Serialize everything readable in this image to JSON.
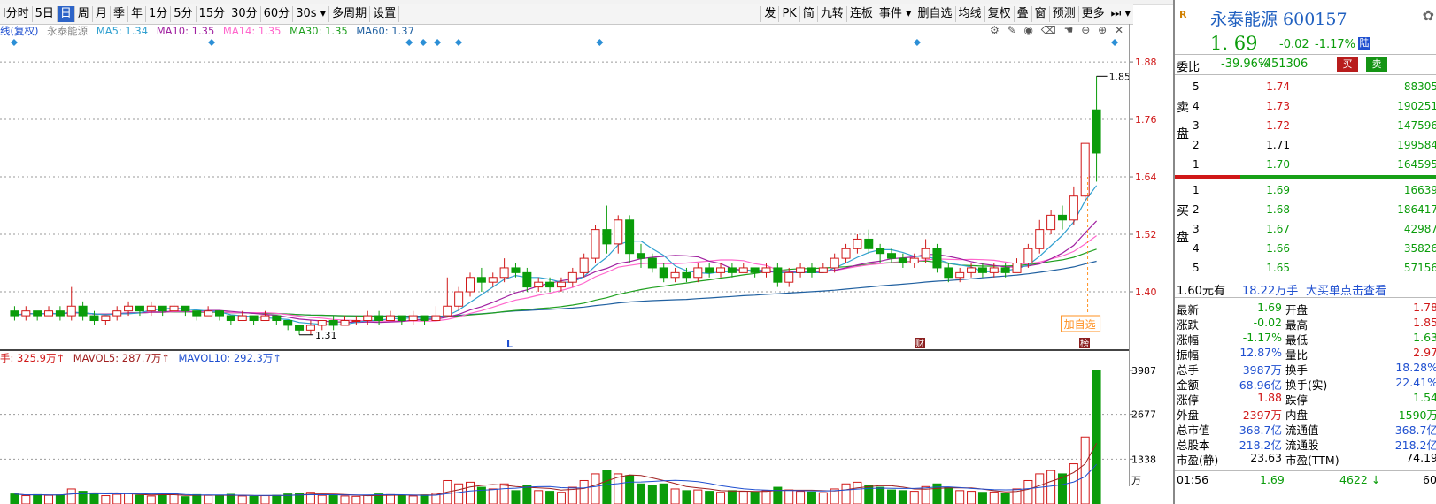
{
  "toolbar": {
    "items": [
      "l分时",
      "5日",
      "日",
      "周",
      "月",
      "季",
      "年",
      "1分",
      "5分",
      "15分",
      "30分",
      "60分",
      "30s ▾",
      "多周期",
      "设置"
    ],
    "active_index": 2,
    "right_items": [
      "发",
      "PK",
      "简",
      "九转",
      "连板",
      "事件 ▾",
      "删自选",
      "均线",
      "复权",
      "叠",
      "窗",
      "预测",
      "更多",
      "⏭ ▾"
    ]
  },
  "ma_line": {
    "prefix": "线(复权)",
    "stock": "永泰能源",
    "ma5": "MA5: 1.34",
    "ma10": "MA10: 1.35",
    "ma14": "MA14: 1.35",
    "ma30": "MA30: 1.35",
    "ma60": "MA60: 1.37"
  },
  "colors": {
    "ma5": "#30a0d0",
    "ma10": "#a020a0",
    "ma14": "#ff66cc",
    "ma30": "#20a020",
    "ma60": "#2060a0",
    "up": "#d01818",
    "down": "#0a9c0a"
  },
  "axis": {
    "price_ticks": [
      "1.88",
      "1.76",
      "1.64",
      "1.52",
      "1.40"
    ],
    "vol_ticks": [
      "3987",
      "2677",
      "1338",
      "万"
    ]
  },
  "annotations": {
    "low": "1.31",
    "high": "1.85",
    "add_watch": "加自选",
    "mark_L": "L",
    "mark_cai": "财",
    "mark_bang": "榜"
  },
  "volume_line": {
    "vol": "手: 325.9万↑",
    "mavol5": "MAVOL5: 287.7万↑",
    "mavol10": "MAVOL10: 292.3万↑"
  },
  "chart_data": {
    "type": "candlestick",
    "price_range": [
      1.28,
      1.93
    ],
    "volume_max": 3987,
    "candles": [
      {
        "o": 1.36,
        "c": 1.35,
        "h": 1.37,
        "l": 1.34,
        "v": 300
      },
      {
        "o": 1.35,
        "c": 1.36,
        "h": 1.37,
        "l": 1.34,
        "v": 250
      },
      {
        "o": 1.36,
        "c": 1.35,
        "h": 1.36,
        "l": 1.34,
        "v": 280
      },
      {
        "o": 1.35,
        "c": 1.36,
        "h": 1.37,
        "l": 1.35,
        "v": 260
      },
      {
        "o": 1.36,
        "c": 1.35,
        "h": 1.37,
        "l": 1.34,
        "v": 270
      },
      {
        "o": 1.35,
        "c": 1.37,
        "h": 1.41,
        "l": 1.34,
        "v": 450
      },
      {
        "o": 1.37,
        "c": 1.35,
        "h": 1.38,
        "l": 1.34,
        "v": 380
      },
      {
        "o": 1.35,
        "c": 1.34,
        "h": 1.36,
        "l": 1.33,
        "v": 300
      },
      {
        "o": 1.34,
        "c": 1.35,
        "h": 1.35,
        "l": 1.33,
        "v": 250
      },
      {
        "o": 1.35,
        "c": 1.36,
        "h": 1.37,
        "l": 1.34,
        "v": 290
      },
      {
        "o": 1.36,
        "c": 1.37,
        "h": 1.38,
        "l": 1.35,
        "v": 320
      },
      {
        "o": 1.37,
        "c": 1.36,
        "h": 1.37,
        "l": 1.35,
        "v": 260
      },
      {
        "o": 1.36,
        "c": 1.37,
        "h": 1.38,
        "l": 1.35,
        "v": 240
      },
      {
        "o": 1.37,
        "c": 1.36,
        "h": 1.37,
        "l": 1.35,
        "v": 270
      },
      {
        "o": 1.36,
        "c": 1.37,
        "h": 1.38,
        "l": 1.36,
        "v": 300
      },
      {
        "o": 1.37,
        "c": 1.36,
        "h": 1.37,
        "l": 1.35,
        "v": 220
      },
      {
        "o": 1.36,
        "c": 1.35,
        "h": 1.36,
        "l": 1.34,
        "v": 280
      },
      {
        "o": 1.35,
        "c": 1.36,
        "h": 1.37,
        "l": 1.35,
        "v": 260
      },
      {
        "o": 1.36,
        "c": 1.35,
        "h": 1.36,
        "l": 1.34,
        "v": 250
      },
      {
        "o": 1.35,
        "c": 1.34,
        "h": 1.35,
        "l": 1.33,
        "v": 290
      },
      {
        "o": 1.34,
        "c": 1.35,
        "h": 1.36,
        "l": 1.34,
        "v": 240
      },
      {
        "o": 1.35,
        "c": 1.34,
        "h": 1.35,
        "l": 1.33,
        "v": 230
      },
      {
        "o": 1.34,
        "c": 1.35,
        "h": 1.36,
        "l": 1.34,
        "v": 250
      },
      {
        "o": 1.35,
        "c": 1.34,
        "h": 1.35,
        "l": 1.33,
        "v": 260
      },
      {
        "o": 1.34,
        "c": 1.33,
        "h": 1.34,
        "l": 1.32,
        "v": 300
      },
      {
        "o": 1.33,
        "c": 1.32,
        "h": 1.33,
        "l": 1.31,
        "v": 330
      },
      {
        "o": 1.32,
        "c": 1.33,
        "h": 1.34,
        "l": 1.31,
        "v": 350
      },
      {
        "o": 1.33,
        "c": 1.34,
        "h": 1.34,
        "l": 1.32,
        "v": 260
      },
      {
        "o": 1.34,
        "c": 1.33,
        "h": 1.35,
        "l": 1.32,
        "v": 250
      },
      {
        "o": 1.33,
        "c": 1.34,
        "h": 1.35,
        "l": 1.33,
        "v": 240
      },
      {
        "o": 1.34,
        "c": 1.34,
        "h": 1.35,
        "l": 1.33,
        "v": 230
      },
      {
        "o": 1.34,
        "c": 1.35,
        "h": 1.36,
        "l": 1.33,
        "v": 260
      },
      {
        "o": 1.35,
        "c": 1.34,
        "h": 1.36,
        "l": 1.33,
        "v": 300
      },
      {
        "o": 1.34,
        "c": 1.35,
        "h": 1.36,
        "l": 1.34,
        "v": 280
      },
      {
        "o": 1.35,
        "c": 1.34,
        "h": 1.35,
        "l": 1.33,
        "v": 260
      },
      {
        "o": 1.34,
        "c": 1.35,
        "h": 1.36,
        "l": 1.33,
        "v": 240
      },
      {
        "o": 1.35,
        "c": 1.34,
        "h": 1.35,
        "l": 1.33,
        "v": 270
      },
      {
        "o": 1.34,
        "c": 1.35,
        "h": 1.37,
        "l": 1.34,
        "v": 320
      },
      {
        "o": 1.35,
        "c": 1.37,
        "h": 1.43,
        "l": 1.35,
        "v": 700
      },
      {
        "o": 1.37,
        "c": 1.4,
        "h": 1.41,
        "l": 1.36,
        "v": 600
      },
      {
        "o": 1.4,
        "c": 1.43,
        "h": 1.44,
        "l": 1.39,
        "v": 650
      },
      {
        "o": 1.43,
        "c": 1.42,
        "h": 1.45,
        "l": 1.4,
        "v": 500
      },
      {
        "o": 1.42,
        "c": 1.43,
        "h": 1.44,
        "l": 1.41,
        "v": 450
      },
      {
        "o": 1.43,
        "c": 1.45,
        "h": 1.47,
        "l": 1.42,
        "v": 600
      },
      {
        "o": 1.45,
        "c": 1.44,
        "h": 1.46,
        "l": 1.43,
        "v": 400
      },
      {
        "o": 1.44,
        "c": 1.41,
        "h": 1.45,
        "l": 1.4,
        "v": 550
      },
      {
        "o": 1.41,
        "c": 1.42,
        "h": 1.43,
        "l": 1.4,
        "v": 400
      },
      {
        "o": 1.42,
        "c": 1.41,
        "h": 1.43,
        "l": 1.4,
        "v": 380
      },
      {
        "o": 1.41,
        "c": 1.42,
        "h": 1.43,
        "l": 1.4,
        "v": 350
      },
      {
        "o": 1.42,
        "c": 1.44,
        "h": 1.45,
        "l": 1.41,
        "v": 500
      },
      {
        "o": 1.44,
        "c": 1.47,
        "h": 1.48,
        "l": 1.43,
        "v": 700
      },
      {
        "o": 1.47,
        "c": 1.53,
        "h": 1.54,
        "l": 1.46,
        "v": 900
      },
      {
        "o": 1.53,
        "c": 1.5,
        "h": 1.58,
        "l": 1.48,
        "v": 1000
      },
      {
        "o": 1.5,
        "c": 1.55,
        "h": 1.56,
        "l": 1.48,
        "v": 900
      },
      {
        "o": 1.55,
        "c": 1.48,
        "h": 1.56,
        "l": 1.46,
        "v": 850
      },
      {
        "o": 1.48,
        "c": 1.47,
        "h": 1.5,
        "l": 1.45,
        "v": 600
      },
      {
        "o": 1.47,
        "c": 1.45,
        "h": 1.48,
        "l": 1.44,
        "v": 550
      },
      {
        "o": 1.45,
        "c": 1.43,
        "h": 1.46,
        "l": 1.42,
        "v": 600
      },
      {
        "o": 1.43,
        "c": 1.44,
        "h": 1.45,
        "l": 1.42,
        "v": 450
      },
      {
        "o": 1.44,
        "c": 1.43,
        "h": 1.45,
        "l": 1.42,
        "v": 400
      },
      {
        "o": 1.43,
        "c": 1.45,
        "h": 1.46,
        "l": 1.42,
        "v": 420
      },
      {
        "o": 1.45,
        "c": 1.44,
        "h": 1.46,
        "l": 1.43,
        "v": 380
      },
      {
        "o": 1.44,
        "c": 1.45,
        "h": 1.46,
        "l": 1.43,
        "v": 350
      },
      {
        "o": 1.45,
        "c": 1.44,
        "h": 1.46,
        "l": 1.43,
        "v": 400
      },
      {
        "o": 1.44,
        "c": 1.45,
        "h": 1.46,
        "l": 1.44,
        "v": 380
      },
      {
        "o": 1.45,
        "c": 1.44,
        "h": 1.45,
        "l": 1.43,
        "v": 360
      },
      {
        "o": 1.44,
        "c": 1.45,
        "h": 1.46,
        "l": 1.43,
        "v": 400
      },
      {
        "o": 1.45,
        "c": 1.42,
        "h": 1.46,
        "l": 1.41,
        "v": 500
      },
      {
        "o": 1.42,
        "c": 1.44,
        "h": 1.45,
        "l": 1.41,
        "v": 420
      },
      {
        "o": 1.44,
        "c": 1.45,
        "h": 1.46,
        "l": 1.43,
        "v": 380
      },
      {
        "o": 1.45,
        "c": 1.44,
        "h": 1.46,
        "l": 1.43,
        "v": 360
      },
      {
        "o": 1.44,
        "c": 1.45,
        "h": 1.46,
        "l": 1.44,
        "v": 340
      },
      {
        "o": 1.45,
        "c": 1.47,
        "h": 1.48,
        "l": 1.44,
        "v": 450
      },
      {
        "o": 1.47,
        "c": 1.49,
        "h": 1.5,
        "l": 1.46,
        "v": 600
      },
      {
        "o": 1.49,
        "c": 1.51,
        "h": 1.52,
        "l": 1.48,
        "v": 650
      },
      {
        "o": 1.51,
        "c": 1.49,
        "h": 1.53,
        "l": 1.48,
        "v": 550
      },
      {
        "o": 1.49,
        "c": 1.48,
        "h": 1.5,
        "l": 1.46,
        "v": 500
      },
      {
        "o": 1.48,
        "c": 1.47,
        "h": 1.49,
        "l": 1.46,
        "v": 420
      },
      {
        "o": 1.47,
        "c": 1.46,
        "h": 1.48,
        "l": 1.45,
        "v": 400
      },
      {
        "o": 1.46,
        "c": 1.47,
        "h": 1.48,
        "l": 1.45,
        "v": 380
      },
      {
        "o": 1.47,
        "c": 1.49,
        "h": 1.51,
        "l": 1.46,
        "v": 520
      },
      {
        "o": 1.49,
        "c": 1.45,
        "h": 1.5,
        "l": 1.44,
        "v": 600
      },
      {
        "o": 1.45,
        "c": 1.43,
        "h": 1.46,
        "l": 1.42,
        "v": 500
      },
      {
        "o": 1.43,
        "c": 1.44,
        "h": 1.45,
        "l": 1.42,
        "v": 400
      },
      {
        "o": 1.44,
        "c": 1.45,
        "h": 1.46,
        "l": 1.43,
        "v": 380
      },
      {
        "o": 1.45,
        "c": 1.44,
        "h": 1.46,
        "l": 1.43,
        "v": 350
      },
      {
        "o": 1.44,
        "c": 1.45,
        "h": 1.46,
        "l": 1.43,
        "v": 360
      },
      {
        "o": 1.45,
        "c": 1.44,
        "h": 1.46,
        "l": 1.43,
        "v": 330
      },
      {
        "o": 1.44,
        "c": 1.46,
        "h": 1.47,
        "l": 1.44,
        "v": 450
      },
      {
        "o": 1.46,
        "c": 1.49,
        "h": 1.5,
        "l": 1.45,
        "v": 700
      },
      {
        "o": 1.49,
        "c": 1.53,
        "h": 1.55,
        "l": 1.48,
        "v": 900
      },
      {
        "o": 1.53,
        "c": 1.56,
        "h": 1.57,
        "l": 1.52,
        "v": 1000
      },
      {
        "o": 1.56,
        "c": 1.55,
        "h": 1.58,
        "l": 1.53,
        "v": 900
      },
      {
        "o": 1.55,
        "c": 1.6,
        "h": 1.62,
        "l": 1.54,
        "v": 1200
      },
      {
        "o": 1.6,
        "c": 1.71,
        "h": 1.71,
        "l": 1.59,
        "v": 2000
      },
      {
        "o": 1.78,
        "c": 1.69,
        "h": 1.85,
        "l": 1.63,
        "v": 3987
      }
    ]
  },
  "quote": {
    "title": "永泰能源 600157",
    "badge": "R",
    "price": "1. 69",
    "change": "-0.02",
    "change_pct": "-1.17%",
    "board": "陆"
  },
  "weibi": {
    "label": "委比",
    "pct": "-39.96%",
    "diff": "-451306",
    "buy": "买",
    "sell": "卖"
  },
  "book": {
    "sell_label": [
      "卖",
      "盘"
    ],
    "buy_label": [
      "买",
      "盘"
    ],
    "asks": [
      {
        "n": "5",
        "p": "1.74",
        "q": "88305",
        "color": "red"
      },
      {
        "n": "4",
        "p": "1.73",
        "q": "190251",
        "color": "red"
      },
      {
        "n": "3",
        "p": "1.72",
        "q": "147596",
        "color": "red"
      },
      {
        "n": "2",
        "p": "1.71",
        "q": "199584",
        "color": "black"
      },
      {
        "n": "1",
        "p": "1.70",
        "q": "164595",
        "color": "green"
      }
    ],
    "bids": [
      {
        "n": "1",
        "p": "1.69",
        "q": "16639",
        "color": "green"
      },
      {
        "n": "2",
        "p": "1.68",
        "q": "186417",
        "color": "green"
      },
      {
        "n": "3",
        "p": "1.67",
        "q": "42987",
        "color": "green"
      },
      {
        "n": "4",
        "p": "1.66",
        "q": "35826",
        "color": "green"
      },
      {
        "n": "5",
        "p": "1.65",
        "q": "57156",
        "color": "green"
      }
    ]
  },
  "bigorder": {
    "price": "1.60元有",
    "amount": "18.22万手",
    "link": "大买单点击查看"
  },
  "stats": [
    {
      "k1": "最新",
      "v1": "1.69",
      "c1": "green",
      "k2": "开盘",
      "v2": "1.78",
      "c2": "red"
    },
    {
      "k1": "涨跌",
      "v1": "-0.02",
      "c1": "green",
      "k2": "最高",
      "v2": "1.85",
      "c2": "red"
    },
    {
      "k1": "涨幅",
      "v1": "-1.17%",
      "c1": "green",
      "k2": "最低",
      "v2": "1.63",
      "c2": "green"
    },
    {
      "k1": "振幅",
      "v1": "12.87%",
      "c1": "blue",
      "k2": "量比",
      "v2": "2.97",
      "c2": "red"
    },
    {
      "k1": "总手",
      "v1": "3987万",
      "c1": "blue",
      "k2": "换手",
      "v2": "18.28%",
      "c2": "blue"
    },
    {
      "k1": "金额",
      "v1": "68.96亿",
      "c1": "blue",
      "k2": "换手(实)",
      "v2": "22.41%",
      "c2": "blue"
    },
    {
      "k1": "涨停",
      "v1": "1.88",
      "c1": "red",
      "k2": "跌停",
      "v2": "1.54",
      "c2": "green"
    },
    {
      "k1": "外盘",
      "v1": "2397万",
      "c1": "red",
      "k2": "内盘",
      "v2": "1590万",
      "c2": "green"
    },
    {
      "k1": "总市值",
      "v1": "368.7亿",
      "c1": "blue",
      "k2": "流通值",
      "v2": "368.7亿",
      "c2": "blue"
    },
    {
      "k1": "总股本",
      "v1": "218.2亿",
      "c1": "blue",
      "k2": "流通股",
      "v2": "218.2亿",
      "c2": "blue"
    },
    {
      "k1": "市盈(静)",
      "v1": "23.63",
      "c1": "black",
      "k2": "市盈(TTM)",
      "v2": "74.19",
      "c2": "black"
    }
  ],
  "tick": {
    "time": "01:56",
    "price": "1.69",
    "vol": "4622",
    "dir": "↓",
    "extra": "60"
  }
}
